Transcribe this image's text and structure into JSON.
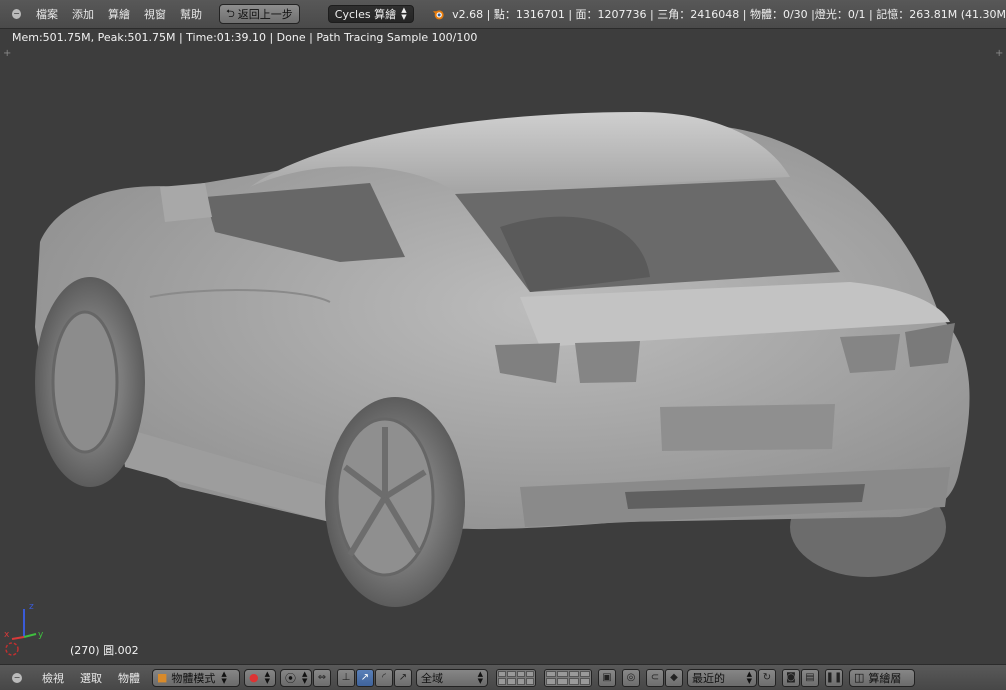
{
  "topbar": {
    "menus": [
      "檔案",
      "添加",
      "算繪",
      "視窗",
      "幫助"
    ],
    "back_button": "返回上一步",
    "engine": "Cycles 算繪",
    "stats": "v2.68 | 點：1316701 | 面：1207736 | 三角：2416048 | 物體：0/30 |燈光：0/1 | 記憶：263.81M (41.30M"
  },
  "render_status": "Mem:501.75M, Peak:501.75M | Time:01:39.10 | Done | Path Tracing Sample 100/100",
  "viewport": {
    "object_label": "(270) 圓.002",
    "axes": {
      "x": "x",
      "y": "y",
      "z": "z"
    }
  },
  "bottombar": {
    "menus": [
      "檢視",
      "選取",
      "物體"
    ],
    "mode": "物體模式",
    "orientation": "全域",
    "snap_target": "最近的",
    "render_layers": "算繪層"
  },
  "colors": {
    "bar_bg": "#4f4f4f",
    "viewport_bg": "#3d3d3d",
    "active_blue": "#4a70aa",
    "blender_orange": "#e87d0d"
  }
}
